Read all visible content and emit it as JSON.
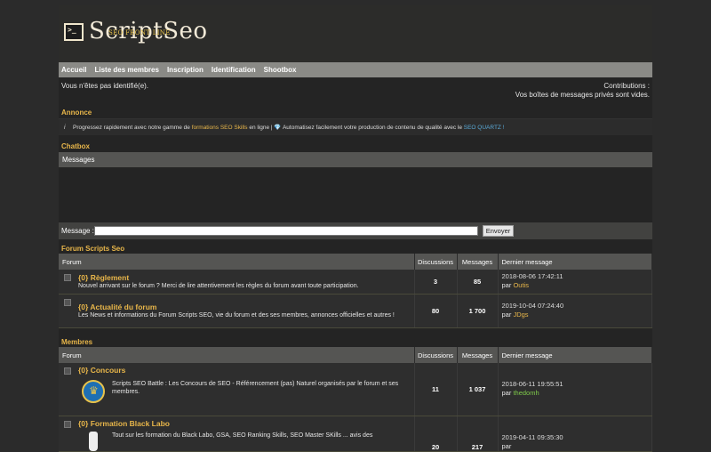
{
  "logo": {
    "term": ">_",
    "title": "ScriptSeo",
    "subtitle": "SEO FRONT LINE"
  },
  "nav": [
    "Accueil",
    "Liste des membres",
    "Inscription",
    "Identification",
    "Shootbox"
  ],
  "userbar": {
    "left": "Vous n'êtes pas identifié(e).",
    "right1": "Contributions :",
    "right2": "Vos boîtes de messages privés sont vides."
  },
  "annonce": {
    "title": "Annonce",
    "icon": "i",
    "t1": "Progressez rapidement avec notre gamme de ",
    "l1": "formations SEO Skills",
    "t2": " en ligne | 💎 Automatisez facilement votre production de contenu de qualité avec le ",
    "l2": "SEO QUARTZ !"
  },
  "chatbox": {
    "title": "Chatbox",
    "head": "Messages",
    "msg_label": "Message :",
    "send": "Envoyer"
  },
  "sections": [
    {
      "title": "Forum Scripts Seo",
      "headers": [
        "Forum",
        "Discussions",
        "Messages",
        "Dernier message"
      ],
      "rows": [
        {
          "title": "{0} Règlement",
          "desc": "Nouvel arrivant sur le forum ? Merci de lire attentivement les règles du forum avant toute participation.",
          "discussions": "3",
          "messages": "85",
          "date": "2018-08-06 17:42:11",
          "par": "par",
          "user": "Outis",
          "user_color": "orange"
        },
        {
          "title": "{0} Actualité du forum",
          "desc": "Les News et informations du Forum Scripts SEO, vie du forum et des ses membres, annonces officielles et autres !",
          "discussions": "80",
          "messages": "1 700",
          "date": "2019-10-04 07:24:40",
          "par": "par",
          "user": "JDgs",
          "user_color": "orange"
        }
      ]
    },
    {
      "title": "Membres",
      "headers": [
        "Forum",
        "Discussions",
        "Messages",
        "Dernier message"
      ],
      "rows": [
        {
          "title": "{0} Concours",
          "desc": "Scripts SEO Battle : Les Concours de SEO - Référencement (pas) Naturel organisés par le forum et ses membres.",
          "discussions": "11",
          "messages": "1 037",
          "date": "2018-06-11 19:55:51",
          "par": "par",
          "user": "thedomh",
          "user_color": "green"
        },
        {
          "title": "{0} Formation Black Labo",
          "desc": "Tout sur les formation du Black Labo, GSA, SEO Ranking Skills, SEO Master SKills ... avis des",
          "discussions": "20",
          "messages": "217",
          "date": "2019-04-11 09:35:30",
          "par": "par",
          "user": "",
          "user_color": "green"
        }
      ]
    }
  ]
}
